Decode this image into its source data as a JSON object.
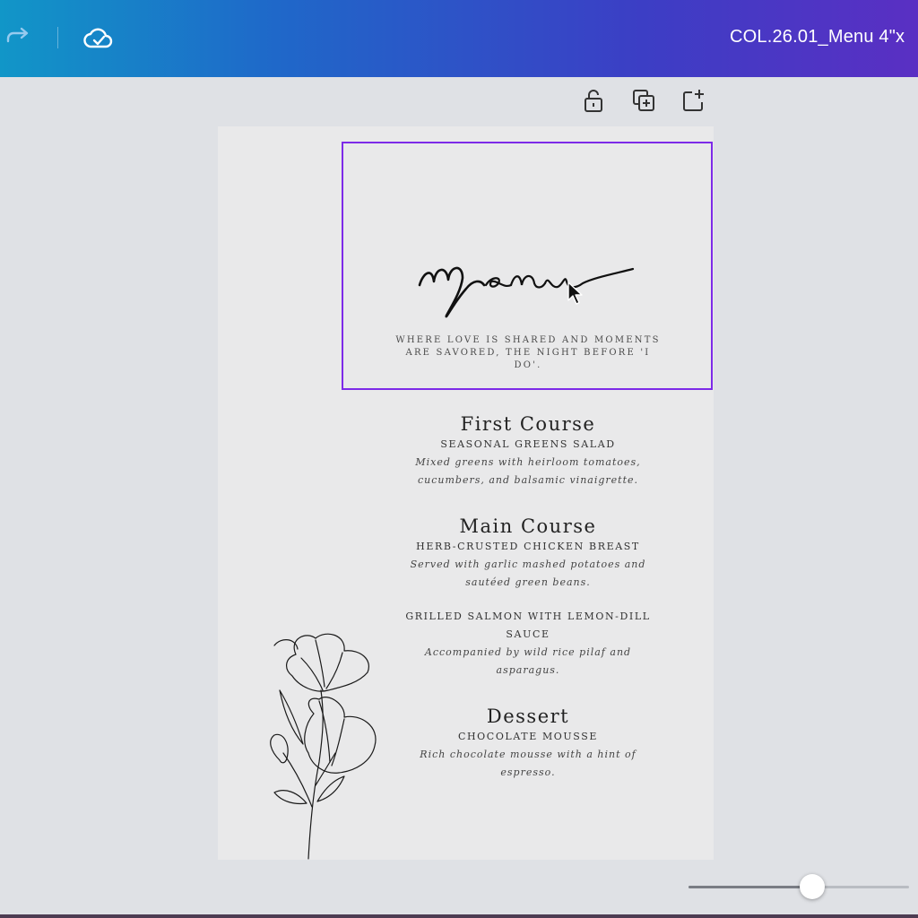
{
  "header": {
    "doc_title": "COL.26.01_Menu 4\"x",
    "icons": [
      "redo-icon",
      "cloud-saved-icon"
    ]
  },
  "page_tools": {
    "icons": [
      "lock-icon",
      "duplicate-page-icon",
      "add-page-icon"
    ]
  },
  "menu": {
    "tagline": "Where love is shared and moments are savored, the night before 'I do'.",
    "sections": [
      {
        "course": "First Course",
        "items": [
          {
            "dish": "Seasonal Greens Salad",
            "description": "Mixed greens with heirloom tomatoes, cucumbers, and balsamic vinaigrette."
          }
        ]
      },
      {
        "course": "Main Course",
        "items": [
          {
            "dish": "Herb-Crusted Chicken Breast",
            "description": "Served with garlic mashed potatoes and sautéed green beans."
          },
          {
            "dish": "Grilled Salmon with Lemon-Dill Sauce",
            "description": "Accompanied by wild rice pilaf and asparagus."
          }
        ]
      },
      {
        "course": "Dessert",
        "items": [
          {
            "dish": "Chocolate Mousse",
            "description": "Rich chocolate mousse with a hint of espresso."
          }
        ]
      }
    ]
  },
  "zoom": {
    "level_fraction": 0.56
  },
  "colors": {
    "selection": "#7d2ae8",
    "topbar_start": "#1196c8",
    "topbar_end": "#5a2fc3"
  }
}
